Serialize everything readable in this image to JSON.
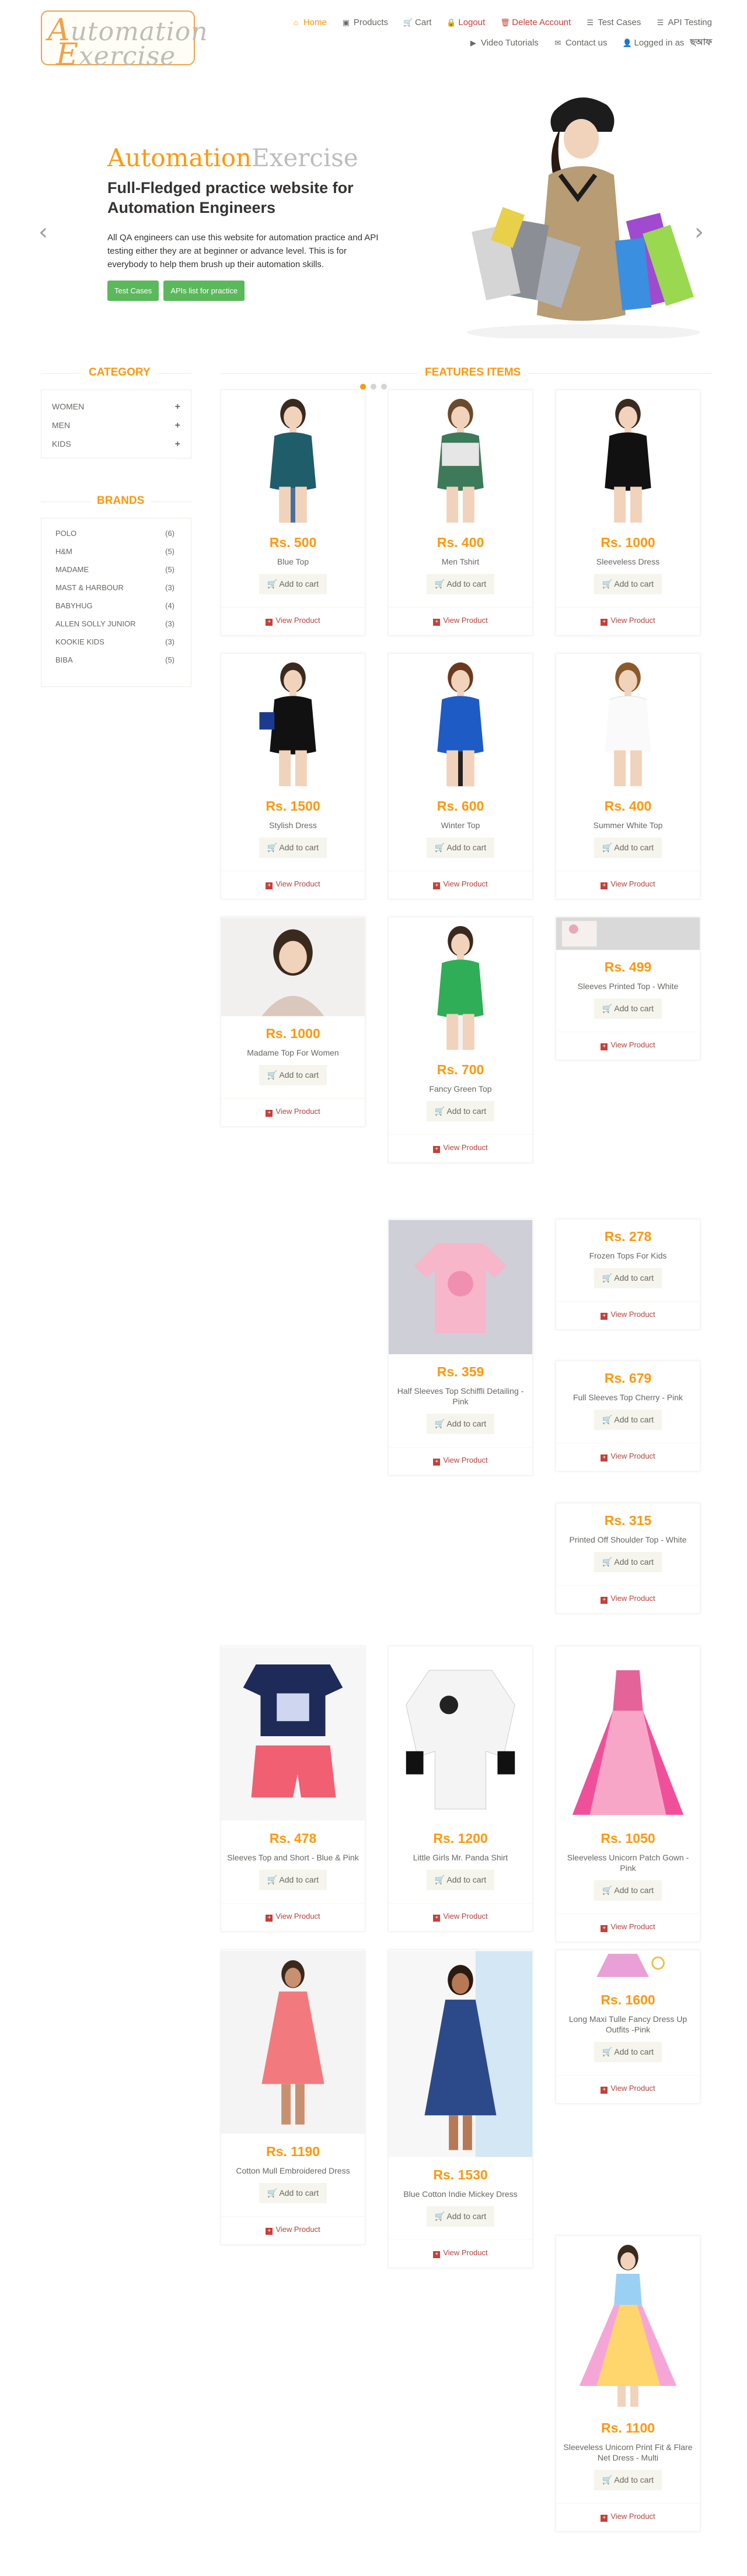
{
  "logo": {
    "line1": "utomation",
    "cap1": "A",
    "line2": "xercise",
    "cap2": "E"
  },
  "nav": [
    {
      "icon": "home-icon",
      "glyph": "⌂",
      "label": "Home",
      "state": "active"
    },
    {
      "icon": "products-icon",
      "glyph": "▣",
      "label": "Products",
      "state": ""
    },
    {
      "icon": "cart-icon",
      "glyph": "🛒",
      "label": "Cart",
      "state": ""
    },
    {
      "icon": "lock-icon",
      "glyph": "🔒",
      "label": "Logout",
      "state": "red"
    },
    {
      "icon": "trash-icon",
      "glyph": "🗑",
      "label": "Delete Account",
      "state": "red"
    },
    {
      "icon": "list-icon",
      "glyph": "☰",
      "label": "Test Cases",
      "state": ""
    },
    {
      "icon": "list-icon",
      "glyph": "☰",
      "label": "API Testing",
      "state": ""
    },
    {
      "icon": "video-icon",
      "glyph": "▶",
      "label": "Video Tutorials",
      "state": ""
    },
    {
      "icon": "envelope-icon",
      "glyph": "✉",
      "label": "Contact us",
      "state": ""
    },
    {
      "icon": "user-icon",
      "glyph": "👤",
      "label": "Logged in as",
      "user": "ছআফ",
      "state": ""
    }
  ],
  "slider": {
    "brand_a": "Automation",
    "brand_b": "Exercise",
    "title": "Full-Fledged practice website for Automation Engineers",
    "description": "All QA engineers can use this website for automation practice and API testing either they are at beginner or advance level. This is for everybody to help them brush up their automation skills.",
    "btn_test_cases": "Test Cases",
    "btn_apis": "APIs list for practice",
    "prev": "‹",
    "next": "›",
    "active_slide": 1,
    "slide_count": 3
  },
  "sidebar": {
    "category_title": "Category",
    "categories": [
      "Women",
      "Men",
      "Kids"
    ],
    "brands_title": "Brands",
    "brands": [
      {
        "name": "Polo",
        "count": "(6)"
      },
      {
        "name": "H&M",
        "count": "(5)"
      },
      {
        "name": "Madame",
        "count": "(5)"
      },
      {
        "name": "Mast & Harbour",
        "count": "(3)"
      },
      {
        "name": "Babyhug",
        "count": "(4)"
      },
      {
        "name": "Allen Solly Junior",
        "count": "(3)"
      },
      {
        "name": "Kookie Kids",
        "count": "(3)"
      },
      {
        "name": "Biba",
        "count": "(5)"
      }
    ]
  },
  "features_title": "Features Items",
  "card_labels": {
    "add": "Add to cart",
    "view": "View Product"
  },
  "products": [
    {
      "price": "Rs. 500",
      "name": "Blue Top"
    },
    {
      "price": "Rs. 400",
      "name": "Men Tshirt"
    },
    {
      "price": "Rs. 1000",
      "name": "Sleeveless Dress"
    },
    {
      "price": "Rs. 1500",
      "name": "Stylish Dress"
    },
    {
      "price": "Rs. 600",
      "name": "Winter Top"
    },
    {
      "price": "Rs. 400",
      "name": "Summer White Top"
    },
    {
      "price": "Rs. 1000",
      "name": "Madame Top For Women"
    },
    {
      "price": "Rs. 700",
      "name": "Fancy Green Top"
    },
    {
      "price": "Rs. 499",
      "name": "Sleeves Printed Top - White"
    },
    {
      "price": "Rs. 359",
      "name": "Half Sleeves Top Schiffli Detailing - Pink"
    },
    {
      "price": "Rs. 278",
      "name": "Frozen Tops For Kids"
    },
    {
      "price": "Rs. 679",
      "name": "Full Sleeves Top Cherry - Pink"
    },
    {
      "price": "Rs. 315",
      "name": "Printed Off Shoulder Top - White"
    },
    {
      "price": "Rs. 478",
      "name": "Sleeves Top and Short - Blue & Pink"
    },
    {
      "price": "Rs. 1200",
      "name": "Little Girls Mr. Panda Shirt"
    },
    {
      "price": "Rs. 1050",
      "name": "Sleeveless Unicorn Patch Gown - Pink"
    },
    {
      "price": "Rs. 1190",
      "name": "Cotton Mull Embroidered Dress"
    },
    {
      "price": "Rs. 1530",
      "name": "Blue Cotton Indie Mickey Dress"
    },
    {
      "price": "Rs. 1600",
      "name": "Long Maxi Tulle Fancy Dress Up Outfits -Pink"
    },
    {
      "price": "Rs. 1100",
      "name": "Sleeveless Unicorn Print Fit & Flare Net Dress - Multi"
    }
  ],
  "colors": {
    "accent": "#fe980f",
    "green": "#5cb85c",
    "red": "#c5403a",
    "text": "#696763"
  }
}
